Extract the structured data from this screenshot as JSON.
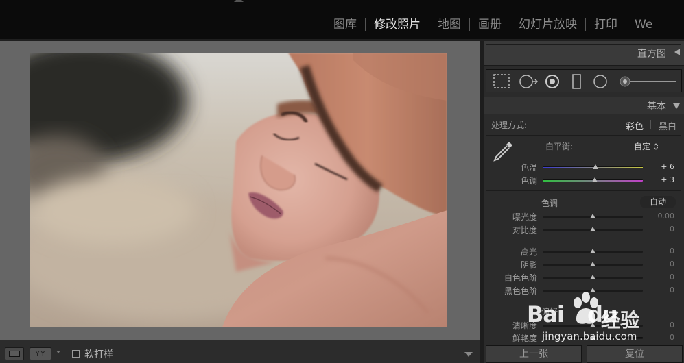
{
  "modules": [
    {
      "label": "图库",
      "active": false
    },
    {
      "label": "修改照片",
      "active": true
    },
    {
      "label": "地图",
      "active": false
    },
    {
      "label": "画册",
      "active": false
    },
    {
      "label": "幻灯片放映",
      "active": false
    },
    {
      "label": "打印",
      "active": false
    },
    {
      "label": "We",
      "active": false
    }
  ],
  "toolbar": {
    "view_icon": "loupe-view-icon",
    "yy_label": "YY",
    "soft_proof_label": "软打样",
    "soft_proof_checked": false
  },
  "right_panel": {
    "histogram_title": "直方图",
    "basic_title": "基本",
    "process": {
      "label": "处理方式:",
      "color_option": "彩色",
      "bw_option": "黑白",
      "selected": "彩色"
    },
    "white_balance": {
      "label": "白平衡:",
      "preset": "自定",
      "sliders": [
        {
          "label": "色温",
          "value": "+ 6",
          "position": 0.53,
          "gradient": [
            "#3a3ad0",
            "#c8c840"
          ]
        },
        {
          "label": "色调",
          "value": "+ 3",
          "position": 0.52,
          "gradient": [
            "#30c040",
            "#c040c8"
          ]
        }
      ]
    },
    "tone": {
      "label": "色调",
      "auto_label": "自动",
      "sliders": [
        {
          "label": "曝光度",
          "value": "0.00",
          "position": 0.5
        },
        {
          "label": "对比度",
          "value": "0",
          "position": 0.5
        }
      ]
    },
    "tone2": {
      "sliders": [
        {
          "label": "高光",
          "value": "0",
          "position": 0.5
        },
        {
          "label": "阴影",
          "value": "0",
          "position": 0.5
        },
        {
          "label": "白色色阶",
          "value": "0",
          "position": 0.5
        },
        {
          "label": "黑色色阶",
          "value": "0",
          "position": 0.5
        }
      ]
    },
    "presence": {
      "label": "偏好",
      "sliders": [
        {
          "label": "清晰度",
          "value": "0",
          "position": 0.5
        },
        {
          "label": "鲜艳度",
          "value": "0",
          "position": 0.5
        }
      ]
    },
    "previous_label": "上一张",
    "reset_label": "复位"
  },
  "watermark": {
    "brand": "Bai",
    "brand2": "du",
    "name": "经验",
    "url": "jingyan.baidu.com"
  }
}
